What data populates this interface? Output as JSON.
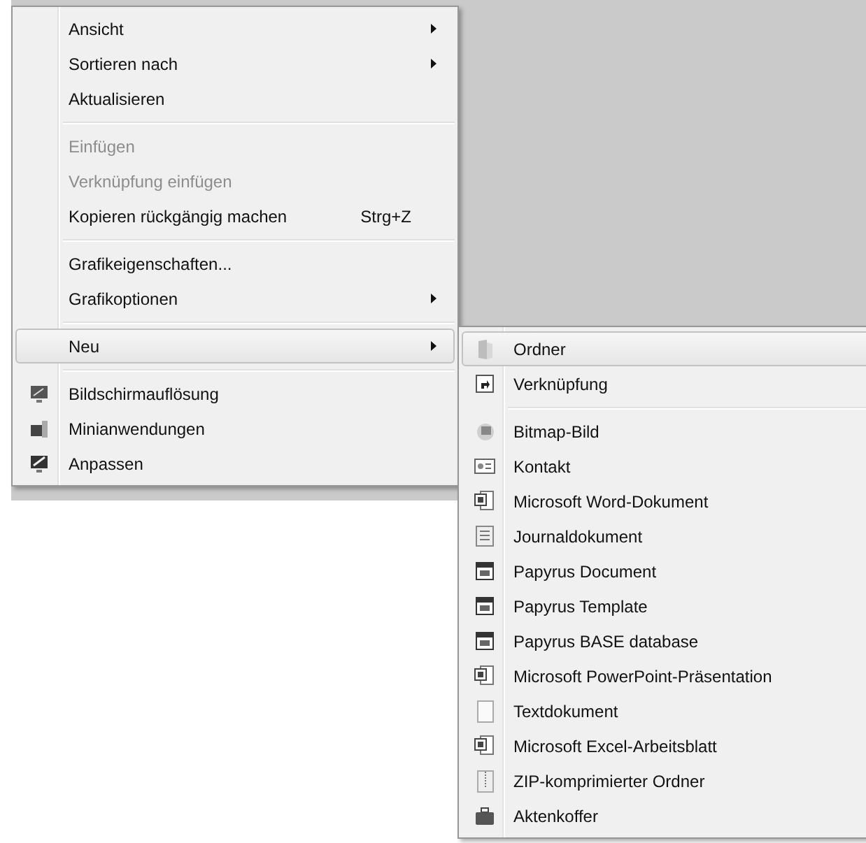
{
  "context_menu": {
    "groups": [
      [
        {
          "label": "Ansicht",
          "disabled": false,
          "submenu": true,
          "selected": false
        },
        {
          "label": "Sortieren nach",
          "disabled": false,
          "submenu": true,
          "selected": false
        },
        {
          "label": "Aktualisieren",
          "disabled": false,
          "submenu": false,
          "selected": false
        }
      ],
      [
        {
          "label": "Einfügen",
          "disabled": true,
          "submenu": false,
          "selected": false
        },
        {
          "label": "Verknüpfung einfügen",
          "disabled": true,
          "submenu": false,
          "selected": false
        },
        {
          "label": "Kopieren rückgängig machen",
          "shortcut": "Strg+Z",
          "disabled": false,
          "submenu": false,
          "selected": false
        }
      ],
      [
        {
          "label": "Grafikeigenschaften...",
          "disabled": false,
          "submenu": false,
          "selected": false
        },
        {
          "label": "Grafikoptionen",
          "disabled": false,
          "submenu": true,
          "selected": false
        }
      ],
      [
        {
          "label": "Neu",
          "disabled": false,
          "submenu": true,
          "selected": true
        }
      ],
      [
        {
          "label": "Bildschirmauflösung",
          "disabled": false,
          "submenu": false,
          "selected": false
        },
        {
          "label": "Minianwendungen",
          "disabled": false,
          "submenu": false,
          "selected": false
        },
        {
          "label": "Anpassen",
          "disabled": false,
          "submenu": false,
          "selected": false
        }
      ]
    ]
  },
  "submenu": {
    "groups": [
      [
        {
          "label": "Ordner",
          "selected": true
        },
        {
          "label": "Verknüpfung",
          "selected": false
        }
      ],
      [
        {
          "label": "Bitmap-Bild",
          "selected": false
        },
        {
          "label": "Kontakt",
          "selected": false
        },
        {
          "label": "Microsoft Word-Dokument",
          "selected": false
        },
        {
          "label": "Journaldokument",
          "selected": false
        },
        {
          "label": "Papyrus Document",
          "selected": false
        },
        {
          "label": "Papyrus Template",
          "selected": false
        },
        {
          "label": "Papyrus BASE database",
          "selected": false
        },
        {
          "label": "Microsoft PowerPoint-Präsentation",
          "selected": false
        },
        {
          "label": "Textdokument",
          "selected": false
        },
        {
          "label": "Microsoft Excel-Arbeitsblatt",
          "selected": false
        },
        {
          "label": "ZIP-komprimierter Ordner",
          "selected": false
        },
        {
          "label": "Aktenkoffer",
          "selected": false
        }
      ]
    ]
  }
}
